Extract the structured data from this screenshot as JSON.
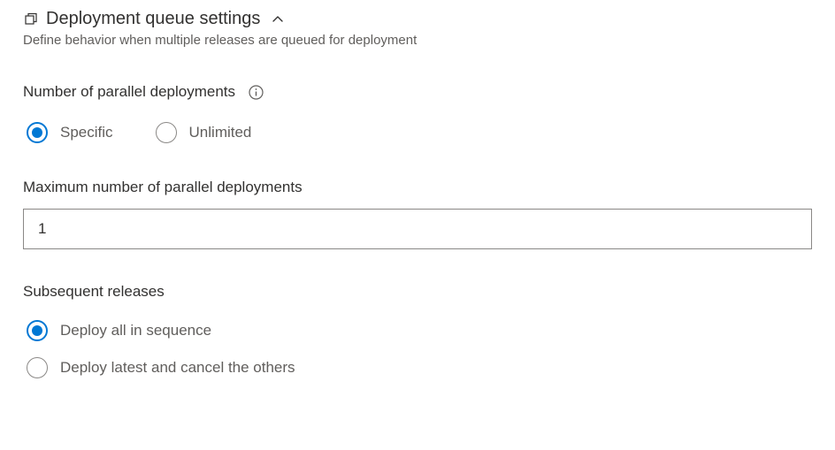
{
  "section": {
    "title": "Deployment queue settings",
    "subtitle": "Define behavior when multiple releases are queued for deployment"
  },
  "parallel": {
    "label": "Number of parallel deployments",
    "options": {
      "specific": "Specific",
      "unlimited": "Unlimited"
    }
  },
  "maxParallel": {
    "label": "Maximum number of parallel deployments",
    "value": "1"
  },
  "subsequent": {
    "label": "Subsequent releases",
    "options": {
      "sequence": "Deploy all in sequence",
      "latest": "Deploy latest and cancel the others"
    }
  }
}
